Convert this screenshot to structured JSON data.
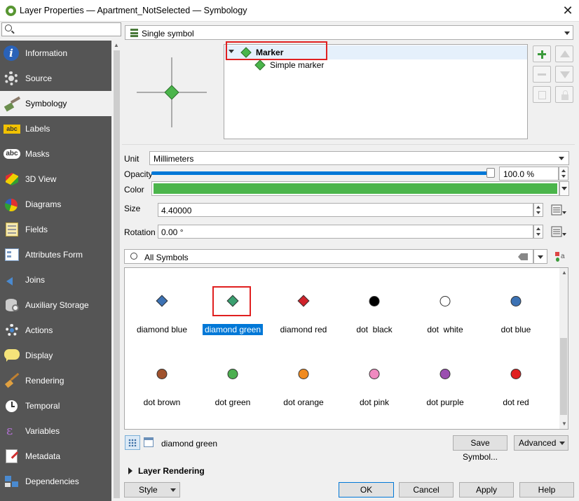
{
  "window": {
    "title": "Layer Properties — Apartment_NotSelected — Symbology"
  },
  "sidebar": {
    "items": [
      {
        "label": "Information",
        "icon": "info-icon"
      },
      {
        "label": "Source",
        "icon": "source-gear-icon"
      },
      {
        "label": "Symbology",
        "icon": "paintbrush-icon"
      },
      {
        "label": "Labels",
        "icon": "abc-labels-icon"
      },
      {
        "label": "Masks",
        "icon": "abc-mask-icon"
      },
      {
        "label": "3D View",
        "icon": "cube-icon"
      },
      {
        "label": "Diagrams",
        "icon": "diagram-icon"
      },
      {
        "label": "Fields",
        "icon": "fields-icon"
      },
      {
        "label": "Attributes Form",
        "icon": "form-icon"
      },
      {
        "label": "Joins",
        "icon": "join-icon"
      },
      {
        "label": "Auxiliary Storage",
        "icon": "database-icon"
      },
      {
        "label": "Actions",
        "icon": "actions-gear-icon"
      },
      {
        "label": "Display",
        "icon": "speech-bubble-icon"
      },
      {
        "label": "Rendering",
        "icon": "brush-icon"
      },
      {
        "label": "Temporal",
        "icon": "clock-icon"
      },
      {
        "label": "Variables",
        "icon": "epsilon-icon"
      },
      {
        "label": "Metadata",
        "icon": "metadata-icon"
      },
      {
        "label": "Dependencies",
        "icon": "dependencies-icon"
      }
    ],
    "selected": "Symbology"
  },
  "renderer": {
    "type": "Single symbol"
  },
  "symbol_tree": {
    "root": "Marker",
    "child": "Simple marker"
  },
  "props": {
    "unit_label": "Unit",
    "unit_value": "Millimeters",
    "opacity_label": "Opacity",
    "opacity_value": "100.0 %",
    "opacity_fraction": 1.0,
    "color_label": "Color",
    "color_value": "#4bb54b",
    "size_label": "Size",
    "size_value": "4.40000",
    "rotation_label": "Rotation",
    "rotation_value": "0.00 °"
  },
  "library": {
    "filter": "All Symbols",
    "symbols": [
      {
        "name": "diamond blue",
        "shape": "diamond",
        "color": "#3c72b4"
      },
      {
        "name": "diamond green",
        "shape": "diamond",
        "color": "#3aa070"
      },
      {
        "name": "diamond red",
        "shape": "diamond",
        "color": "#d0222a"
      },
      {
        "name": "dot  black",
        "shape": "dot",
        "color": "#000000"
      },
      {
        "name": "dot  white",
        "shape": "dot",
        "color": "#ffffff"
      },
      {
        "name": "dot blue",
        "shape": "dot",
        "color": "#3c72b4"
      },
      {
        "name": "dot brown",
        "shape": "dot",
        "color": "#a0522d"
      },
      {
        "name": "dot green",
        "shape": "dot",
        "color": "#4caf50"
      },
      {
        "name": "dot orange",
        "shape": "dot",
        "color": "#f08a1e"
      },
      {
        "name": "dot pink",
        "shape": "dot",
        "color": "#f08ac0"
      },
      {
        "name": "dot purple",
        "shape": "dot",
        "color": "#9b4fb0"
      },
      {
        "name": "dot red",
        "shape": "dot",
        "color": "#e02020"
      }
    ],
    "selected_name": "diamond green"
  },
  "bottom": {
    "save_symbol": "Save Symbol...",
    "advanced": "Advanced",
    "layer_rendering": "Layer Rendering",
    "style": "Style",
    "ok": "OK",
    "cancel": "Cancel",
    "apply": "Apply",
    "help": "Help"
  },
  "colors": {
    "accent": "#0078d7",
    "highlight": "#e02020",
    "marker_green": "#4bb54b"
  }
}
